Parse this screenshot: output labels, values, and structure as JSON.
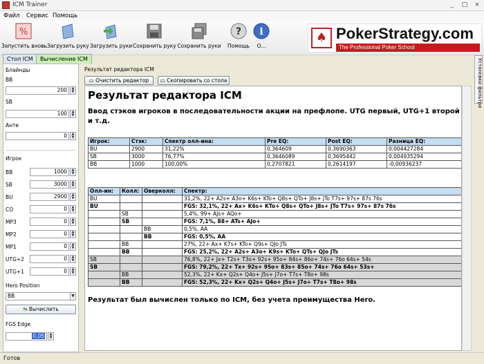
{
  "window": {
    "title": "ICM Trainer",
    "controls": [
      "_",
      "□",
      "×"
    ]
  },
  "menu": [
    "Файл",
    "Сервис",
    "Помощь"
  ],
  "toolbar": [
    {
      "label": "Запустить вновь",
      "icon": "restart-icon"
    },
    {
      "label": "Загрузить руку",
      "icon": "load-hand-icon"
    },
    {
      "label": "Загрузить руки",
      "icon": "load-hands-icon"
    },
    {
      "label": "Сохранить руку",
      "icon": "save-hand-icon"
    },
    {
      "label": "Сохранить руки",
      "icon": "save-hands-icon"
    },
    {
      "label": "Помощь",
      "icon": "help-icon"
    },
    {
      "label": "О...",
      "icon": "info-icon"
    }
  ],
  "logo": {
    "brand": "PokerStrategy.com",
    "tagline": "The Professional Poker School"
  },
  "tabs": [
    "Стол ICM",
    "Вычисление ICM"
  ],
  "side_tab": "Установки фильтра",
  "left": {
    "blinds_title": "Блайнды",
    "bb": {
      "label": "BB",
      "value": "200"
    },
    "sb": {
      "label": "SB",
      "value": "100"
    },
    "ante": {
      "label": "Анте",
      "value": "0"
    },
    "player_title": "Игрок",
    "players": [
      {
        "label": "BB",
        "value": "1000"
      },
      {
        "label": "SB",
        "value": "3000"
      },
      {
        "label": "BU",
        "value": "2900"
      },
      {
        "label": "CO",
        "value": "0"
      },
      {
        "label": "MP3",
        "value": "0"
      },
      {
        "label": "MP2",
        "value": "0"
      },
      {
        "label": "MP1",
        "value": "0"
      },
      {
        "label": "UTG+2",
        "value": "0"
      },
      {
        "label": "UTG+1",
        "value": "0"
      }
    ],
    "hero_label": "Hero Position",
    "hero_value": "BB",
    "calc_button": "Вычислить",
    "fgs_label": "FGS Edge",
    "fgs_value": "0,05"
  },
  "right": {
    "group_title": "Результат редактора ICM",
    "clear_button": "Очистить редактор",
    "copy_button": "Скопировать со стола",
    "heading": "Результат редактора ICM",
    "intro": "Ввод стэков игроков в последовательности акции на префлопе. UTG первый, UTG+1 второй и т.д.",
    "table1": {
      "headers": [
        "Игрок:",
        "Стэк:",
        "Спектр олл-ина:",
        "Pre EQ:",
        "Post EQ:",
        "Разница EQ:"
      ],
      "rows": [
        [
          "BU",
          "2900",
          "31,22%",
          "0,364609",
          "0,3690363",
          "0,004427284"
        ],
        [
          "SB",
          "3000",
          "76,77%",
          "0,3646089",
          "0,3695442",
          "0,004935294"
        ],
        [
          "BB",
          "1000",
          "100,00%",
          "0,2707821",
          "0,2614197",
          "-0,00936237"
        ]
      ]
    },
    "table2": {
      "headers": [
        "Олл-ин:",
        "Колл:",
        "Оверколл:",
        "Спектр:"
      ],
      "rows": [
        {
          "c": [
            "BU",
            "",
            "",
            "31,2%, 22+ A2s+ A3o+ K6s+ KTo+ Q8s+ QTo+ J8s+ JTo T7s+ 97s+ 87s 76s"
          ],
          "bold": false,
          "gray": false
        },
        {
          "c": [
            "BU",
            "",
            "",
            "FGS: 32,1%, 22+ Ax+ K6s+ KTo+ Q8s+ QTo+ J8s+ JTo T7s+ 97s+ 87s 76s"
          ],
          "bold": true,
          "gray": false
        },
        {
          "c": [
            "",
            "SB",
            "",
            "5,4%, 99+ AJs+ AQo+"
          ],
          "bold": false,
          "gray": false
        },
        {
          "c": [
            "",
            "SB",
            "",
            "FGS: 7,1%, 88+ ATs+ AJo+"
          ],
          "bold": true,
          "gray": false
        },
        {
          "c": [
            "",
            "",
            "BB",
            "0,5%, AA"
          ],
          "bold": false,
          "gray": false
        },
        {
          "c": [
            "",
            "",
            "BB",
            "FGS: 0,5%, AA"
          ],
          "bold": true,
          "gray": false
        },
        {
          "c": [
            "",
            "BB",
            "",
            "27%, 22+ Ax+ K7s+ KTo+ Q9s+ QJo JTs"
          ],
          "bold": false,
          "gray": false
        },
        {
          "c": [
            "",
            "BB",
            "",
            "FGS: 25,2%, 22+ A2s+ A3o+ K9s+ KTo+ QTs+ QJo JTs"
          ],
          "bold": true,
          "gray": false
        },
        {
          "c": [
            "SB",
            "",
            "",
            "76,8%, 22+ Jx+ T2s+ T3o+ 92s+ 95o+ 84s+ 86o+ 74s+ 76o 64s+ 54s"
          ],
          "bold": false,
          "gray": true
        },
        {
          "c": [
            "SB",
            "",
            "",
            "FGS: 79,2%, 22+ Tx+ 92s+ 95o+ 83s+ 85o+ 74s+ 76o 64s+ 53s+"
          ],
          "bold": true,
          "gray": true
        },
        {
          "c": [
            "",
            "BB",
            "",
            "52,3%, 22+ Kx+ Q2s+ Q4o+ J5s+ J7o+ T7s+ T8o+ 98s"
          ],
          "bold": false,
          "gray": true
        },
        {
          "c": [
            "",
            "BB",
            "",
            "FGS: 52,3%, 22+ Kx+ Q2s+ Q4o+ J5s+ J7o+ T7s+ T8o+ 98s"
          ],
          "bold": true,
          "gray": true
        }
      ]
    },
    "footer": "Результат был вычислен только по ICM, без учета преимущества Hero."
  },
  "status": "Готов",
  "colors": {
    "accent_blue": "#c6ddf2",
    "tab_green": "#c9f0b4",
    "brand_red": "#c8191f"
  }
}
